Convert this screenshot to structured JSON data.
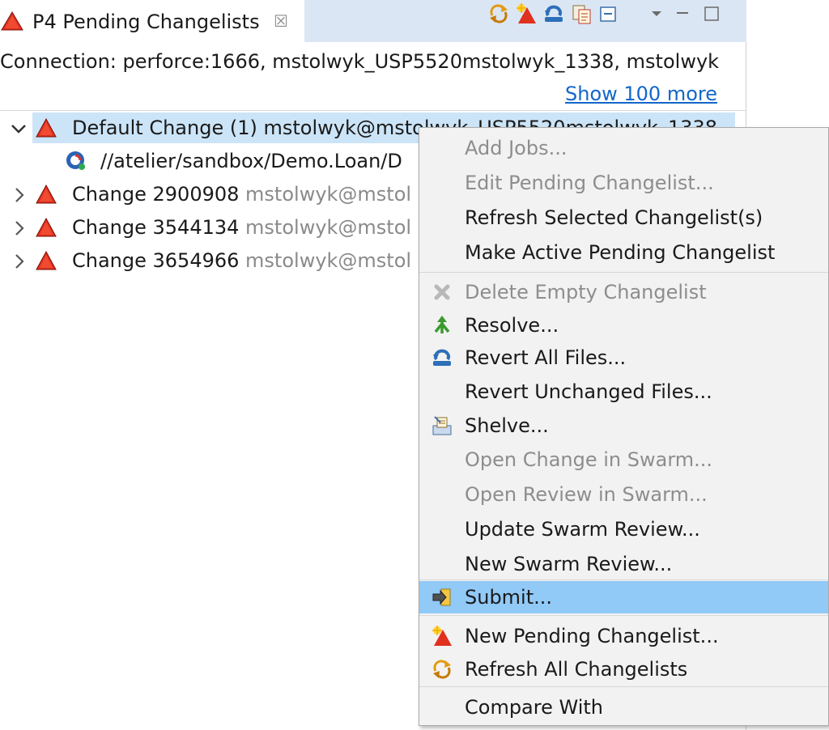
{
  "view": {
    "title": "P4 Pending Changelists",
    "close_glyph": "☒",
    "connection": "Connection: perforce:1666, mstolwyk_USP5520mstolwyk_1338, mstolwyk",
    "show_more": "Show 100 more",
    "toolbar_icons": [
      "refresh-all-icon",
      "new-pending-changelist-icon",
      "revert-icon",
      "copy-icon",
      "collapse-all-icon"
    ],
    "view_menu_icons": [
      "view-menu-icon",
      "minimize-icon",
      "maximize-icon"
    ]
  },
  "tree": {
    "default_change": {
      "label": "Default Change (1) mstolwyk@mstolwyk_USP5520mstolwyk_1338",
      "expanded": true
    },
    "file": {
      "label": "//atelier/sandbox/Demo.Loan/D"
    },
    "changes": [
      {
        "id": "Change 2900908",
        "user": "mstolwyk@mstol"
      },
      {
        "id": "Change 3544134",
        "user": "mstolwyk@mstol"
      },
      {
        "id": "Change 3654966",
        "user": "mstolwyk@mstol"
      }
    ]
  },
  "context_menu": {
    "items": [
      {
        "label": "Add Jobs...",
        "enabled": false,
        "icon": ""
      },
      {
        "label": "Edit Pending Changelist...",
        "enabled": false,
        "icon": ""
      },
      {
        "label": "Refresh Selected Changelist(s)",
        "enabled": true,
        "icon": ""
      },
      {
        "label": "Make Active Pending Changelist",
        "enabled": true,
        "icon": ""
      },
      {
        "label": "Delete Empty Changelist",
        "enabled": false,
        "icon": "delete-icon"
      },
      {
        "label": "Resolve...",
        "enabled": true,
        "icon": "resolve-icon"
      },
      {
        "label": "Revert All Files...",
        "enabled": true,
        "icon": "revert-icon"
      },
      {
        "label": "Revert Unchanged Files...",
        "enabled": true,
        "icon": ""
      },
      {
        "label": "Shelve...",
        "enabled": true,
        "icon": "shelve-icon"
      },
      {
        "label": "Open Change in Swarm...",
        "enabled": false,
        "icon": ""
      },
      {
        "label": "Open Review in Swarm...",
        "enabled": false,
        "icon": ""
      },
      {
        "label": "Update Swarm Review...",
        "enabled": true,
        "icon": ""
      },
      {
        "label": "New Swarm Review...",
        "enabled": true,
        "icon": ""
      },
      {
        "label": "Submit...",
        "enabled": true,
        "icon": "submit-icon",
        "hovered": true
      },
      {
        "label": "New Pending Changelist...",
        "enabled": true,
        "icon": "new-pending-changelist-icon"
      },
      {
        "label": "Refresh All Changelists",
        "enabled": true,
        "icon": "refresh-all-icon"
      },
      {
        "label": "Compare With",
        "enabled": true,
        "icon": ""
      }
    ]
  },
  "colors": {
    "selection": "#cce4f7",
    "menu_hover": "#91c9f7",
    "link": "#1267c9",
    "tab_bar": "#dbe6f4"
  }
}
